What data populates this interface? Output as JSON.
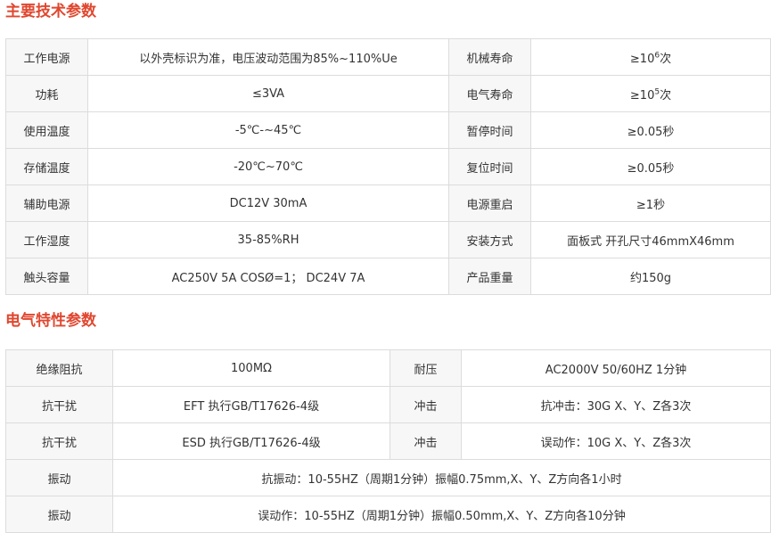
{
  "sections": {
    "main_specs": {
      "title": "主要技术参数",
      "rows": [
        {
          "l1": "工作电源",
          "v1": "以外壳标识为准，电压波动范围为85%~110%Ue",
          "l2": "机械寿命",
          "v2_pre": "≥10",
          "v2_sup": "6",
          "v2_post": "次"
        },
        {
          "l1": "功耗",
          "v1": "≤3VA",
          "l2": "电气寿命",
          "v2_pre": "≥10",
          "v2_sup": "5",
          "v2_post": "次"
        },
        {
          "l1": "使用温度",
          "v1": "-5℃-~45℃",
          "l2": "暂停时间",
          "v2": "≥0.05秒"
        },
        {
          "l1": "存储温度",
          "v1": "-20℃~70℃",
          "l2": "复位时间",
          "v2": "≥0.05秒"
        },
        {
          "l1": "辅助电源",
          "v1": "DC12V 30mA",
          "l2": "电源重启",
          "v2": "≥1秒"
        },
        {
          "l1": "工作湿度",
          "v1": "35-85%RH",
          "l2": "安装方式",
          "v2": "面板式 开孔尺寸46mmX46mm"
        },
        {
          "l1": "触头容量",
          "v1": "AC250V 5A COSØ=1； DC24V  7A",
          "l2": "产品重量",
          "v2": "约150g"
        }
      ]
    },
    "electrical_specs": {
      "title": "电气特性参数",
      "rows": [
        {
          "l1": "绝缘阻抗",
          "v1": "100MΩ",
          "l2": "耐压",
          "v2": "AC2000V 50/60HZ 1分钟"
        },
        {
          "l1": "抗干扰",
          "v1": "EFT 执行GB/T17626-4级",
          "l2": "冲击",
          "v2": "抗冲击：30G  X、Y、Z各3次"
        },
        {
          "l1": "抗干扰",
          "v1": "ESD 执行GB/T17626-4级",
          "l2": "冲击",
          "v2": "误动作：10G  X、Y、Z各3次"
        }
      ],
      "wide_rows": [
        {
          "l1": "振动",
          "v": "抗振动：10-55HZ（周期1分钟）振幅0.75mm,X、Y、Z方向各1小时"
        },
        {
          "l1": "振动",
          "v": "误动作：10-55HZ（周期1分钟）振幅0.50mm,X、Y、Z方向各10分钟"
        }
      ]
    }
  }
}
